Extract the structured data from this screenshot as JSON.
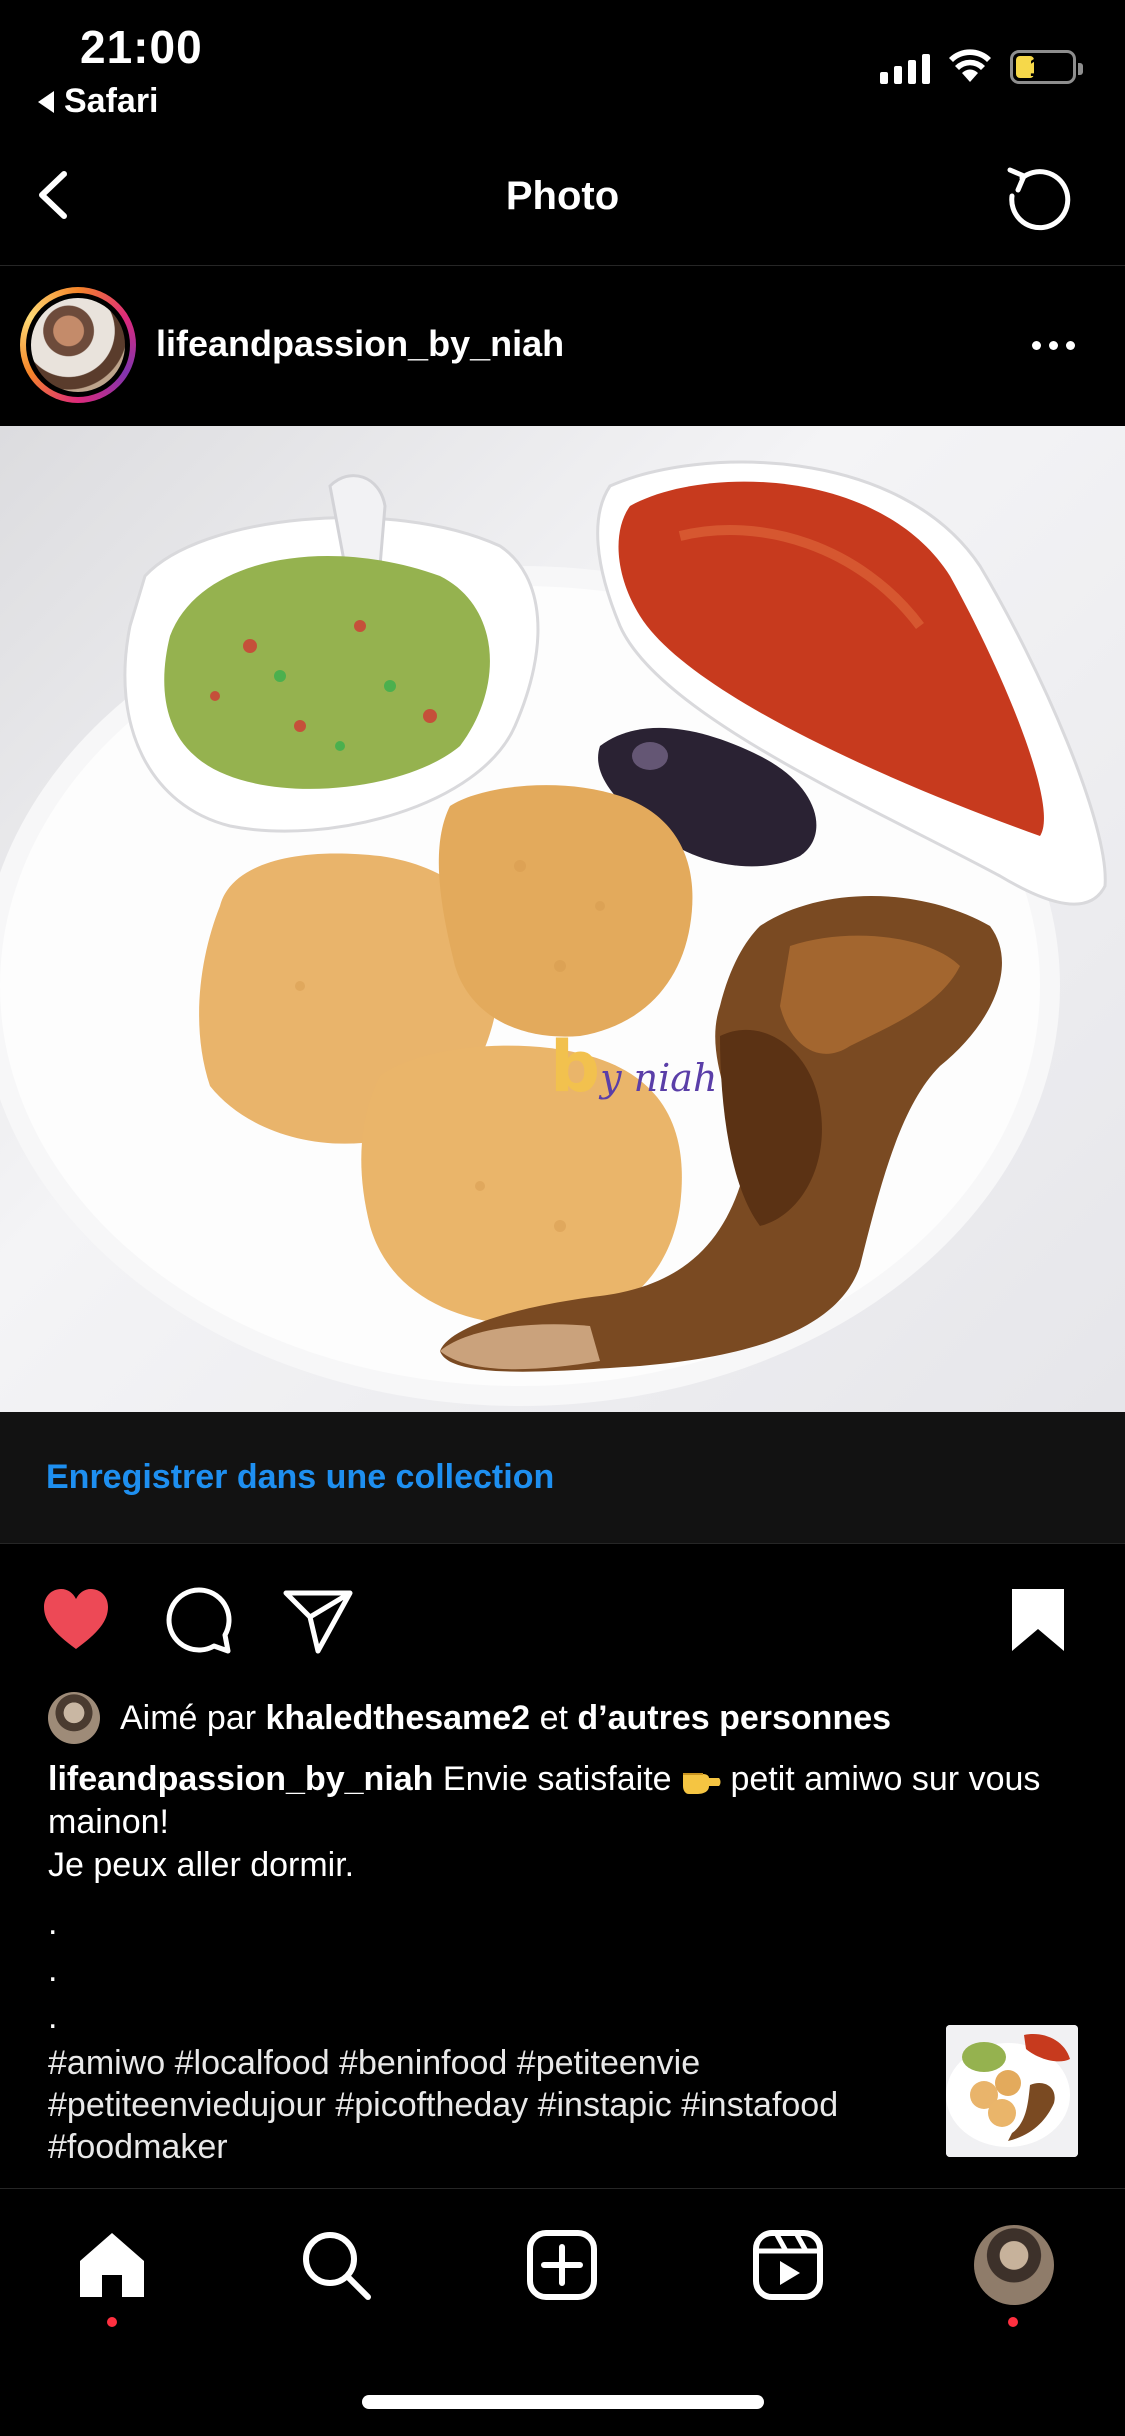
{
  "status_bar": {
    "time": "21:00",
    "back_app": "Safari",
    "battery": "11"
  },
  "nav": {
    "title": "Photo"
  },
  "post": {
    "username": "lifeandpassion_by_niah",
    "watermark_b": "b",
    "watermark_text": "y niah",
    "save_to_collection": "Enregistrer dans une collection",
    "liked": true,
    "saved": true
  },
  "likes": {
    "prefix": "Aimé par",
    "user": "khaledthesame2",
    "middle": "et",
    "others": "d’autres personnes"
  },
  "caption": {
    "username": "lifeandpassion_by_niah",
    "text_before_emoji": "Envie satisfaite",
    "text_after_emoji": "petit amiwo sur vous mainon!",
    "line2": "Je peux aller dormir.",
    "dot1": ".",
    "dot2": ".",
    "dot3": ".",
    "hashtags": "#amiwo #localfood #beninfood #petiteenvie #petiteenviedujour #picoftheday #instapic #instafood #foodmaker"
  },
  "tabbar": {
    "items": [
      "home-icon",
      "search-icon",
      "create-icon",
      "reels-icon",
      "profile-avatar"
    ],
    "active": "home",
    "notification_color": "#ff3040"
  },
  "colors": {
    "accent_blue": "#1e8ff0",
    "like_red": "#ed4956"
  }
}
